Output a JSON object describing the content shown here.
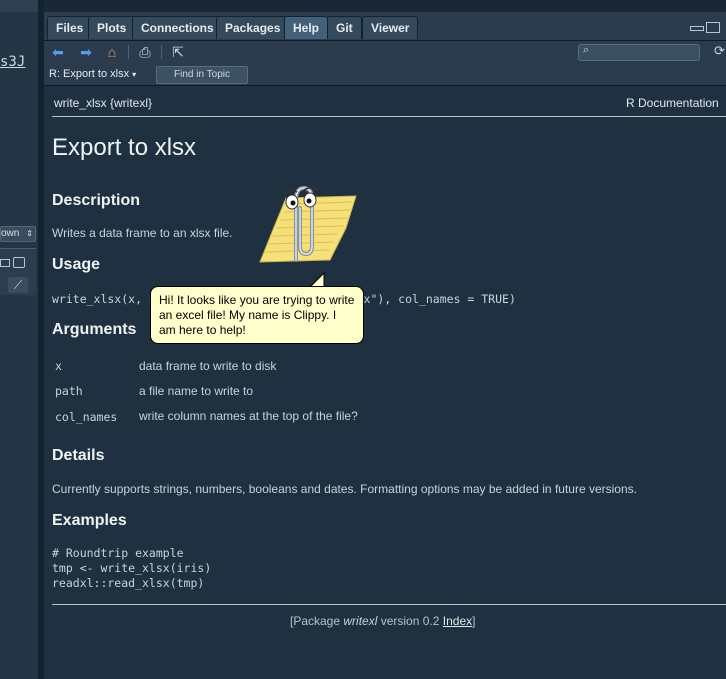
{
  "left_panel": {
    "code_fragment": "s3J",
    "dropdown_label": "own"
  },
  "tabs": [
    {
      "label": "Files",
      "active": false
    },
    {
      "label": "Plots",
      "active": false
    },
    {
      "label": "Connections",
      "active": false
    },
    {
      "label": "Packages",
      "active": false
    },
    {
      "label": "Help",
      "active": true
    },
    {
      "label": "Git",
      "active": false
    },
    {
      "label": "Viewer",
      "active": false
    }
  ],
  "toolbar": {
    "search_placeholder": "",
    "topic_dropdown": "R: Export to xlsx",
    "find_in_topic": "Find in Topic"
  },
  "doc": {
    "header_left": "write_xlsx {writexl}",
    "header_right": "R Documentation",
    "title": "Export to xlsx",
    "description_heading": "Description",
    "description": "Writes a data frame to an xlsx file.",
    "usage_heading": "Usage",
    "usage_code": "write_xlsx(x, path = tempfile(fileext = \".xlsx\"), col_names = TRUE)",
    "arguments_heading": "Arguments",
    "arguments": [
      {
        "name": "x",
        "desc": "data frame to write to disk"
      },
      {
        "name": "path",
        "desc": "a file name to write to"
      },
      {
        "name": "col_names",
        "desc": "write column names at the top of the file?"
      }
    ],
    "details_heading": "Details",
    "details": "Currently supports strings, numbers, booleans and dates. Formatting options may be added in future versions.",
    "examples_heading": "Examples",
    "examples": [
      "# Roundtrip example",
      "tmp <- write_xlsx(iris)",
      "readxl::read_xlsx(tmp)"
    ],
    "footer_prefix": "[Package ",
    "footer_pkg": "writexl",
    "footer_version": " version 0.2 ",
    "footer_index": "Index",
    "footer_suffix": "]"
  },
  "clippy": {
    "message": "Hi! It looks like you are trying to write an excel file! My name is Clippy. I am here to help!"
  },
  "colors": {
    "link_icon": "#5a9ae6",
    "pane_bg": "#1f3141",
    "bubble_bg": "#ffffcc"
  }
}
